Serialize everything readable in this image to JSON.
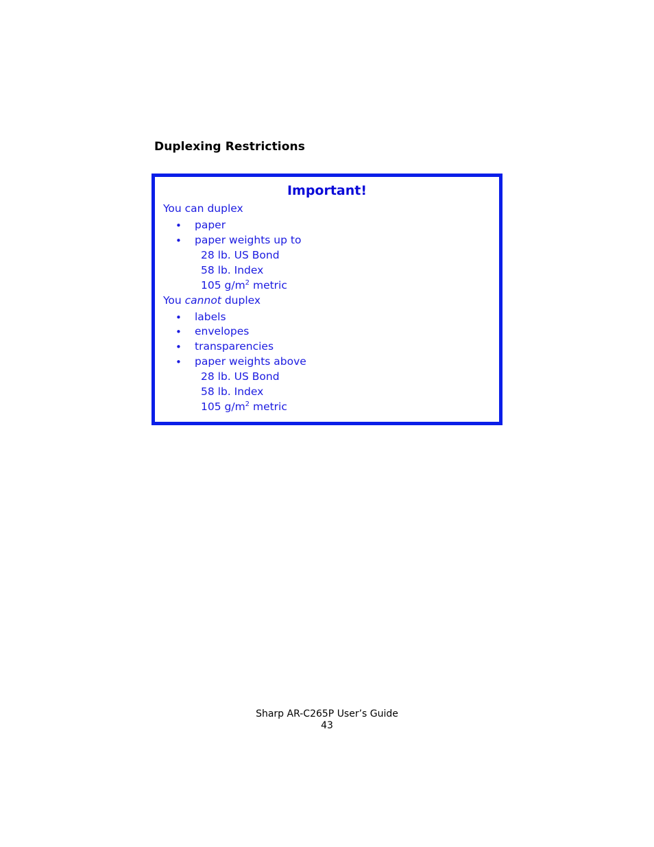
{
  "section": {
    "title": "Duplexing Restrictions"
  },
  "important_box": {
    "title": "Important!",
    "can": {
      "lead_prefix": "You ",
      "lead_emphasis": "can",
      "lead_suffix": " duplex",
      "items": [
        {
          "label": "paper",
          "sub": []
        },
        {
          "label": "paper weights up to",
          "sub": [
            {
              "text": "28 lb. US Bond"
            },
            {
              "text": "58 lb. Index"
            },
            {
              "base": "105 g/m",
              "sup": "2",
              "suffix": " metric"
            }
          ]
        }
      ]
    },
    "cannot": {
      "lead_prefix": "You ",
      "lead_emphasis": "cannot",
      "lead_suffix": " duplex",
      "items": [
        {
          "label": "labels"
        },
        {
          "label": "envelopes"
        },
        {
          "label": "transparencies"
        },
        {
          "label": "paper weights above",
          "sub": [
            {
              "text": "28 lb. US Bond"
            },
            {
              "text": "58 lb. Index"
            },
            {
              "base": "105 g/m",
              "sup": "2",
              "suffix": " metric"
            }
          ]
        }
      ]
    },
    "bullet_glyph": "•",
    "colors": {
      "border": "#0a1ee8",
      "text": "#1a1ae0"
    }
  },
  "footer": {
    "guide_title": "Sharp AR-C265P User’s Guide",
    "page_number": "43"
  }
}
